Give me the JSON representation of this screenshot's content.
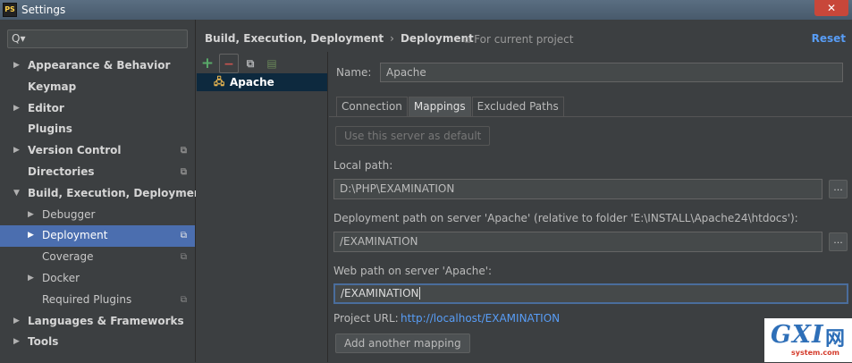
{
  "window": {
    "title": "Settings",
    "app_icon_text": "PS",
    "close_glyph": "✕"
  },
  "search": {
    "placeholder": "",
    "icon_glyph": "Q▾"
  },
  "sidebar": {
    "items": [
      {
        "label": "Appearance & Behavior",
        "level": 0,
        "expandable": true,
        "expanded": false,
        "copy_icon": false
      },
      {
        "label": "Keymap",
        "level": 0,
        "expandable": false,
        "copy_icon": false
      },
      {
        "label": "Editor",
        "level": 0,
        "expandable": true,
        "expanded": false,
        "copy_icon": false
      },
      {
        "label": "Plugins",
        "level": 0,
        "expandable": false,
        "copy_icon": false
      },
      {
        "label": "Version Control",
        "level": 0,
        "expandable": true,
        "expanded": false,
        "copy_icon": true
      },
      {
        "label": "Directories",
        "level": 0,
        "expandable": false,
        "copy_icon": true
      },
      {
        "label": "Build, Execution, Deployment",
        "level": 0,
        "expandable": true,
        "expanded": true,
        "copy_icon": false
      },
      {
        "label": "Debugger",
        "level": 1,
        "expandable": true,
        "expanded": false,
        "copy_icon": false
      },
      {
        "label": "Deployment",
        "level": 1,
        "expandable": true,
        "expanded": false,
        "copy_icon": true,
        "selected": true
      },
      {
        "label": "Coverage",
        "level": 1,
        "expandable": false,
        "copy_icon": true
      },
      {
        "label": "Docker",
        "level": 1,
        "expandable": true,
        "expanded": false,
        "copy_icon": false
      },
      {
        "label": "Required Plugins",
        "level": 1,
        "expandable": false,
        "copy_icon": true
      },
      {
        "label": "Languages & Frameworks",
        "level": 0,
        "expandable": true,
        "expanded": false,
        "copy_icon": false
      },
      {
        "label": "Tools",
        "level": 0,
        "expandable": true,
        "expanded": false,
        "copy_icon": false
      }
    ]
  },
  "header": {
    "breadcrumb": [
      "Build, Execution, Deployment",
      "Deployment"
    ],
    "breadcrumb_sep": "›",
    "scope": "For current project",
    "reset": "Reset"
  },
  "servers": {
    "toolbar": {
      "add": "+",
      "remove": "−",
      "copy": "⧉",
      "default": "▤"
    },
    "items": [
      {
        "label": "Apache"
      }
    ]
  },
  "detail": {
    "name_label": "Name:",
    "name_value": "Apache",
    "tabs": [
      {
        "label": "Connection",
        "active": false
      },
      {
        "label": "Mappings",
        "active": true
      },
      {
        "label": "Excluded Paths",
        "active": false
      }
    ],
    "use_default_button": "Use this server as default",
    "local_path_label": "Local path:",
    "local_path_value": "D:\\PHP\\EXAMINATION",
    "deployment_path_label": "Deployment path on server 'Apache' (relative to folder 'E:\\INSTALL\\Apache24\\htdocs'):",
    "deployment_path_value": "/EXAMINATION",
    "web_path_label": "Web path on server 'Apache':",
    "web_path_value": "/EXAMINATION",
    "browse_label": "...",
    "project_url_label": "Project URL:",
    "project_url_value": "http://localhost/EXAMINATION",
    "add_mapping_button": "Add another mapping"
  },
  "watermark": {
    "main": "GXI",
    "cn": "网",
    "sub": "system.com"
  },
  "colors": {
    "background": "#3c3f41",
    "selection": "#4b6eaf",
    "link": "#589df6",
    "focus_border": "#4a6d9c",
    "list_selection": "#0d293e"
  }
}
